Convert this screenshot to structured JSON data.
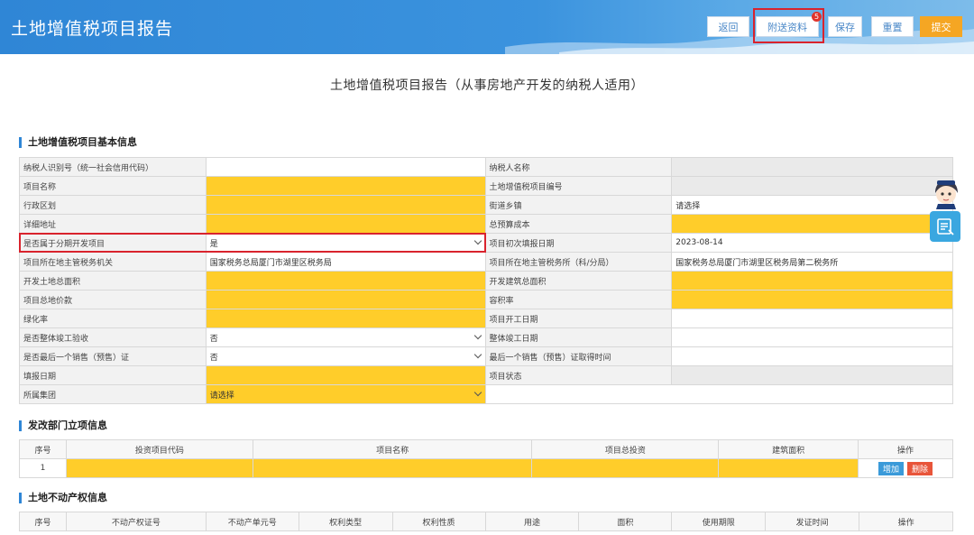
{
  "header": {
    "title": "土地增值税项目报告",
    "buttons": {
      "back": "返回",
      "attach": "附送资料",
      "save": "保存",
      "reset": "重置",
      "submit": "提交"
    },
    "attach_badge": "5"
  },
  "doc_title": "土地增值税项目报告（从事房地产开发的纳税人适用）",
  "basic_section": {
    "title": "土地增值税项目基本信息",
    "rows": [
      {
        "l1": "纳税人识别号（统一社会信用代码）",
        "v1": "",
        "l2": "纳税人名称",
        "v2": "",
        "s1": "w",
        "s2": "g"
      },
      {
        "l1": "项目名称",
        "v1": "",
        "l2": "土地增值税项目编号",
        "v2": "",
        "s1": "y",
        "s2": "g"
      },
      {
        "l1": "行政区划",
        "v1": "",
        "l2": "街道乡镇",
        "v2": "请选择",
        "s1": "y",
        "s2": "w"
      },
      {
        "l1": "详细地址",
        "v1": "",
        "l2": "总预算成本",
        "v2": "",
        "s1": "y",
        "s2": "y"
      },
      {
        "l1": "是否属于分期开发项目",
        "v1": "是",
        "l2": "项目初次填报日期",
        "v2": "2023-08-14",
        "s1": "w",
        "s2": "w",
        "dd1": true
      },
      {
        "l1": "项目所在地主管税务机关",
        "v1": "国家税务总局厦门市湖里区税务局",
        "l2": "项目所在地主管税务所（科/分局）",
        "v2": "国家税务总局厦门市湖里区税务局第二税务所",
        "s1": "w",
        "s2": "w"
      },
      {
        "l1": "开发土地总面积",
        "v1": "",
        "l2": "开发建筑总面积",
        "v2": "",
        "s1": "y",
        "s2": "y"
      },
      {
        "l1": "项目总地价款",
        "v1": "",
        "l2": "容积率",
        "v2": "",
        "s1": "y",
        "s2": "y"
      },
      {
        "l1": "绿化率",
        "v1": "",
        "l2": "项目开工日期",
        "v2": "",
        "s1": "y",
        "s2": "w"
      },
      {
        "l1": "是否整体竣工验收",
        "v1": "否",
        "l2": "整体竣工日期",
        "v2": "",
        "s1": "w",
        "s2": "w",
        "dd1": true
      },
      {
        "l1": "是否最后一个销售（预售）证",
        "v1": "否",
        "l2": "最后一个销售（预售）证取得时间",
        "v2": "",
        "s1": "w",
        "s2": "w",
        "dd1": true
      },
      {
        "l1": "填报日期",
        "v1": "",
        "l2": "项目状态",
        "v2": "",
        "s1": "y",
        "s2": "g"
      },
      {
        "l1": "所属集团",
        "v1": "请选择",
        "l2": "",
        "v2": "",
        "s1": "y",
        "s2": "w",
        "dd1": true,
        "half": true
      }
    ]
  },
  "project_section": {
    "title": "发改部门立项信息",
    "headers": [
      "序号",
      "投资项目代码",
      "项目名称",
      "项目总投资",
      "建筑面积",
      "操作"
    ],
    "rows": [
      {
        "index": "1"
      }
    ],
    "actions": {
      "add": "增加",
      "delete": "删除"
    }
  },
  "property_section": {
    "title": "土地不动产权信息",
    "headers": [
      "序号",
      "不动产权证号",
      "不动产单元号",
      "权利类型",
      "权利性质",
      "用途",
      "面积",
      "使用期限",
      "发证时间",
      "操作"
    ]
  },
  "colors": {
    "header_blue": "#2f86d6",
    "required_yellow": "#ffcd2a",
    "highlight_red": "#d9232d",
    "submit_orange": "#f5a623"
  }
}
